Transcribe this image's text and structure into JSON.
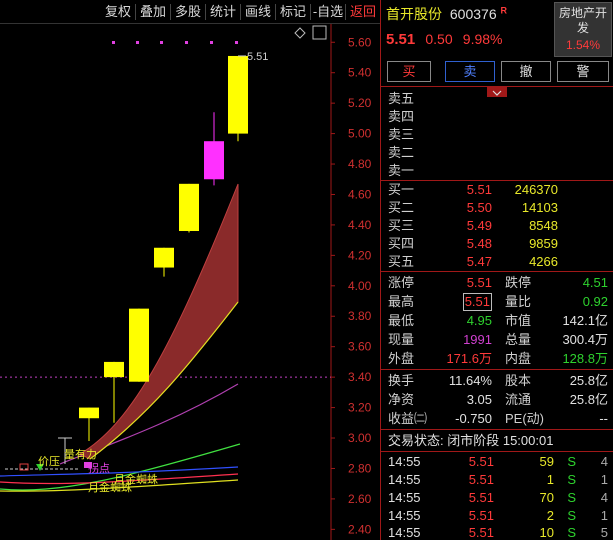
{
  "toolbar": {
    "buttons": [
      "复权",
      "叠加",
      "多股",
      "统计",
      "画线",
      "标记",
      "-自选",
      "返回"
    ]
  },
  "stock": {
    "name": "首开股份",
    "code": "600376",
    "badge": "R",
    "price": "5.51",
    "change": "0.50",
    "change_pct": "9.98%",
    "sector_name": "房地产开发",
    "sector_pct": "1.54%"
  },
  "trade_buttons": [
    "买",
    "卖",
    "撤",
    "警"
  ],
  "collapse_icon": "chevron-down",
  "asks": [
    {
      "label": "卖五",
      "price": "",
      "vol": ""
    },
    {
      "label": "卖四",
      "price": "",
      "vol": ""
    },
    {
      "label": "卖三",
      "price": "",
      "vol": ""
    },
    {
      "label": "卖二",
      "price": "",
      "vol": ""
    },
    {
      "label": "卖一",
      "price": "",
      "vol": ""
    }
  ],
  "bids": [
    {
      "label": "买一",
      "price": "5.51",
      "vol": "246370"
    },
    {
      "label": "买二",
      "price": "5.50",
      "vol": "14103"
    },
    {
      "label": "买三",
      "price": "5.49",
      "vol": "8548"
    },
    {
      "label": "买四",
      "price": "5.48",
      "vol": "9859"
    },
    {
      "label": "买五",
      "price": "5.47",
      "vol": "4266"
    }
  ],
  "stats": [
    {
      "l1": "涨停",
      "v1": "5.51",
      "c1": "red",
      "l2": "跌停",
      "v2": "4.51",
      "c2": "green"
    },
    {
      "l1": "最高",
      "v1": "5.51",
      "c1": "red",
      "boxed": true,
      "l2": "量比",
      "v2": "0.92",
      "c2": "green"
    },
    {
      "l1": "最低",
      "v1": "4.95",
      "c1": "green",
      "l2": "市值",
      "v2": "142.1亿",
      "c2": "white"
    },
    {
      "l1": "现量",
      "v1": "1991",
      "c1": "purple",
      "l2": "总量",
      "v2": "300.4万",
      "c2": "white"
    },
    {
      "l1": "外盘",
      "v1": "171.6万",
      "c1": "red",
      "l2": "内盘",
      "v2": "128.8万",
      "c2": "green"
    }
  ],
  "stats2": [
    {
      "l1": "换手",
      "v1": "11.64%",
      "l2": "股本",
      "v2": "25.8亿"
    },
    {
      "l1": "净资",
      "v1": "3.05",
      "l2": "流通",
      "v2": "25.8亿"
    },
    {
      "l1": "收益㈡",
      "v1": "-0.750",
      "l2": "PE(动)",
      "v2": "--"
    }
  ],
  "trade_status": "交易状态: 闭市阶段 15:00:01",
  "ticks": [
    {
      "time": "14:55",
      "price": "5.51",
      "vol": "59",
      "side": "S",
      "num": "4"
    },
    {
      "time": "14:55",
      "price": "5.51",
      "vol": "1",
      "side": "S",
      "num": "1"
    },
    {
      "time": "14:55",
      "price": "5.51",
      "vol": "70",
      "side": "S",
      "num": "4"
    },
    {
      "time": "14:55",
      "price": "5.51",
      "vol": "2",
      "side": "S",
      "num": "1"
    },
    {
      "time": "14:55",
      "price": "5.51",
      "vol": "10",
      "side": "S",
      "num": "5"
    }
  ],
  "chart_data": {
    "type": "candlestick",
    "y_ticks": [
      "5.60",
      "5.40",
      "5.20",
      "5.00",
      "4.80",
      "4.60",
      "4.40",
      "4.20",
      "4.00",
      "3.80",
      "3.60",
      "3.40",
      "3.20",
      "3.00",
      "2.80",
      "2.60",
      "2.40"
    ],
    "ylim": [
      2.33,
      5.72
    ],
    "high_label": "5.51",
    "ref_line": 3.4,
    "candles": [
      {
        "o": 3.2,
        "c": 3.13,
        "h": 3.2,
        "l": 2.98,
        "color": "yellow"
      },
      {
        "o": 3.4,
        "c": 3.5,
        "h": 3.5,
        "l": 3.1,
        "color": "yellow"
      },
      {
        "o": 3.37,
        "c": 3.85,
        "h": 3.85,
        "l": 3.37,
        "color": "yellow"
      },
      {
        "o": 4.12,
        "c": 4.25,
        "h": 4.25,
        "l": 4.06,
        "color": "yellow"
      },
      {
        "o": 4.36,
        "c": 4.67,
        "h": 4.67,
        "l": 4.35,
        "color": "yellow"
      },
      {
        "o": 4.7,
        "c": 4.95,
        "h": 5.14,
        "l": 4.66,
        "color": "magenta"
      },
      {
        "o": 5.0,
        "c": 5.51,
        "h": 5.51,
        "l": 4.95,
        "color": "yellow"
      }
    ],
    "annotations": [
      "量有力",
      "价压",
      "拐点",
      "月金蜘蛛",
      "月金蜘蛛"
    ]
  }
}
